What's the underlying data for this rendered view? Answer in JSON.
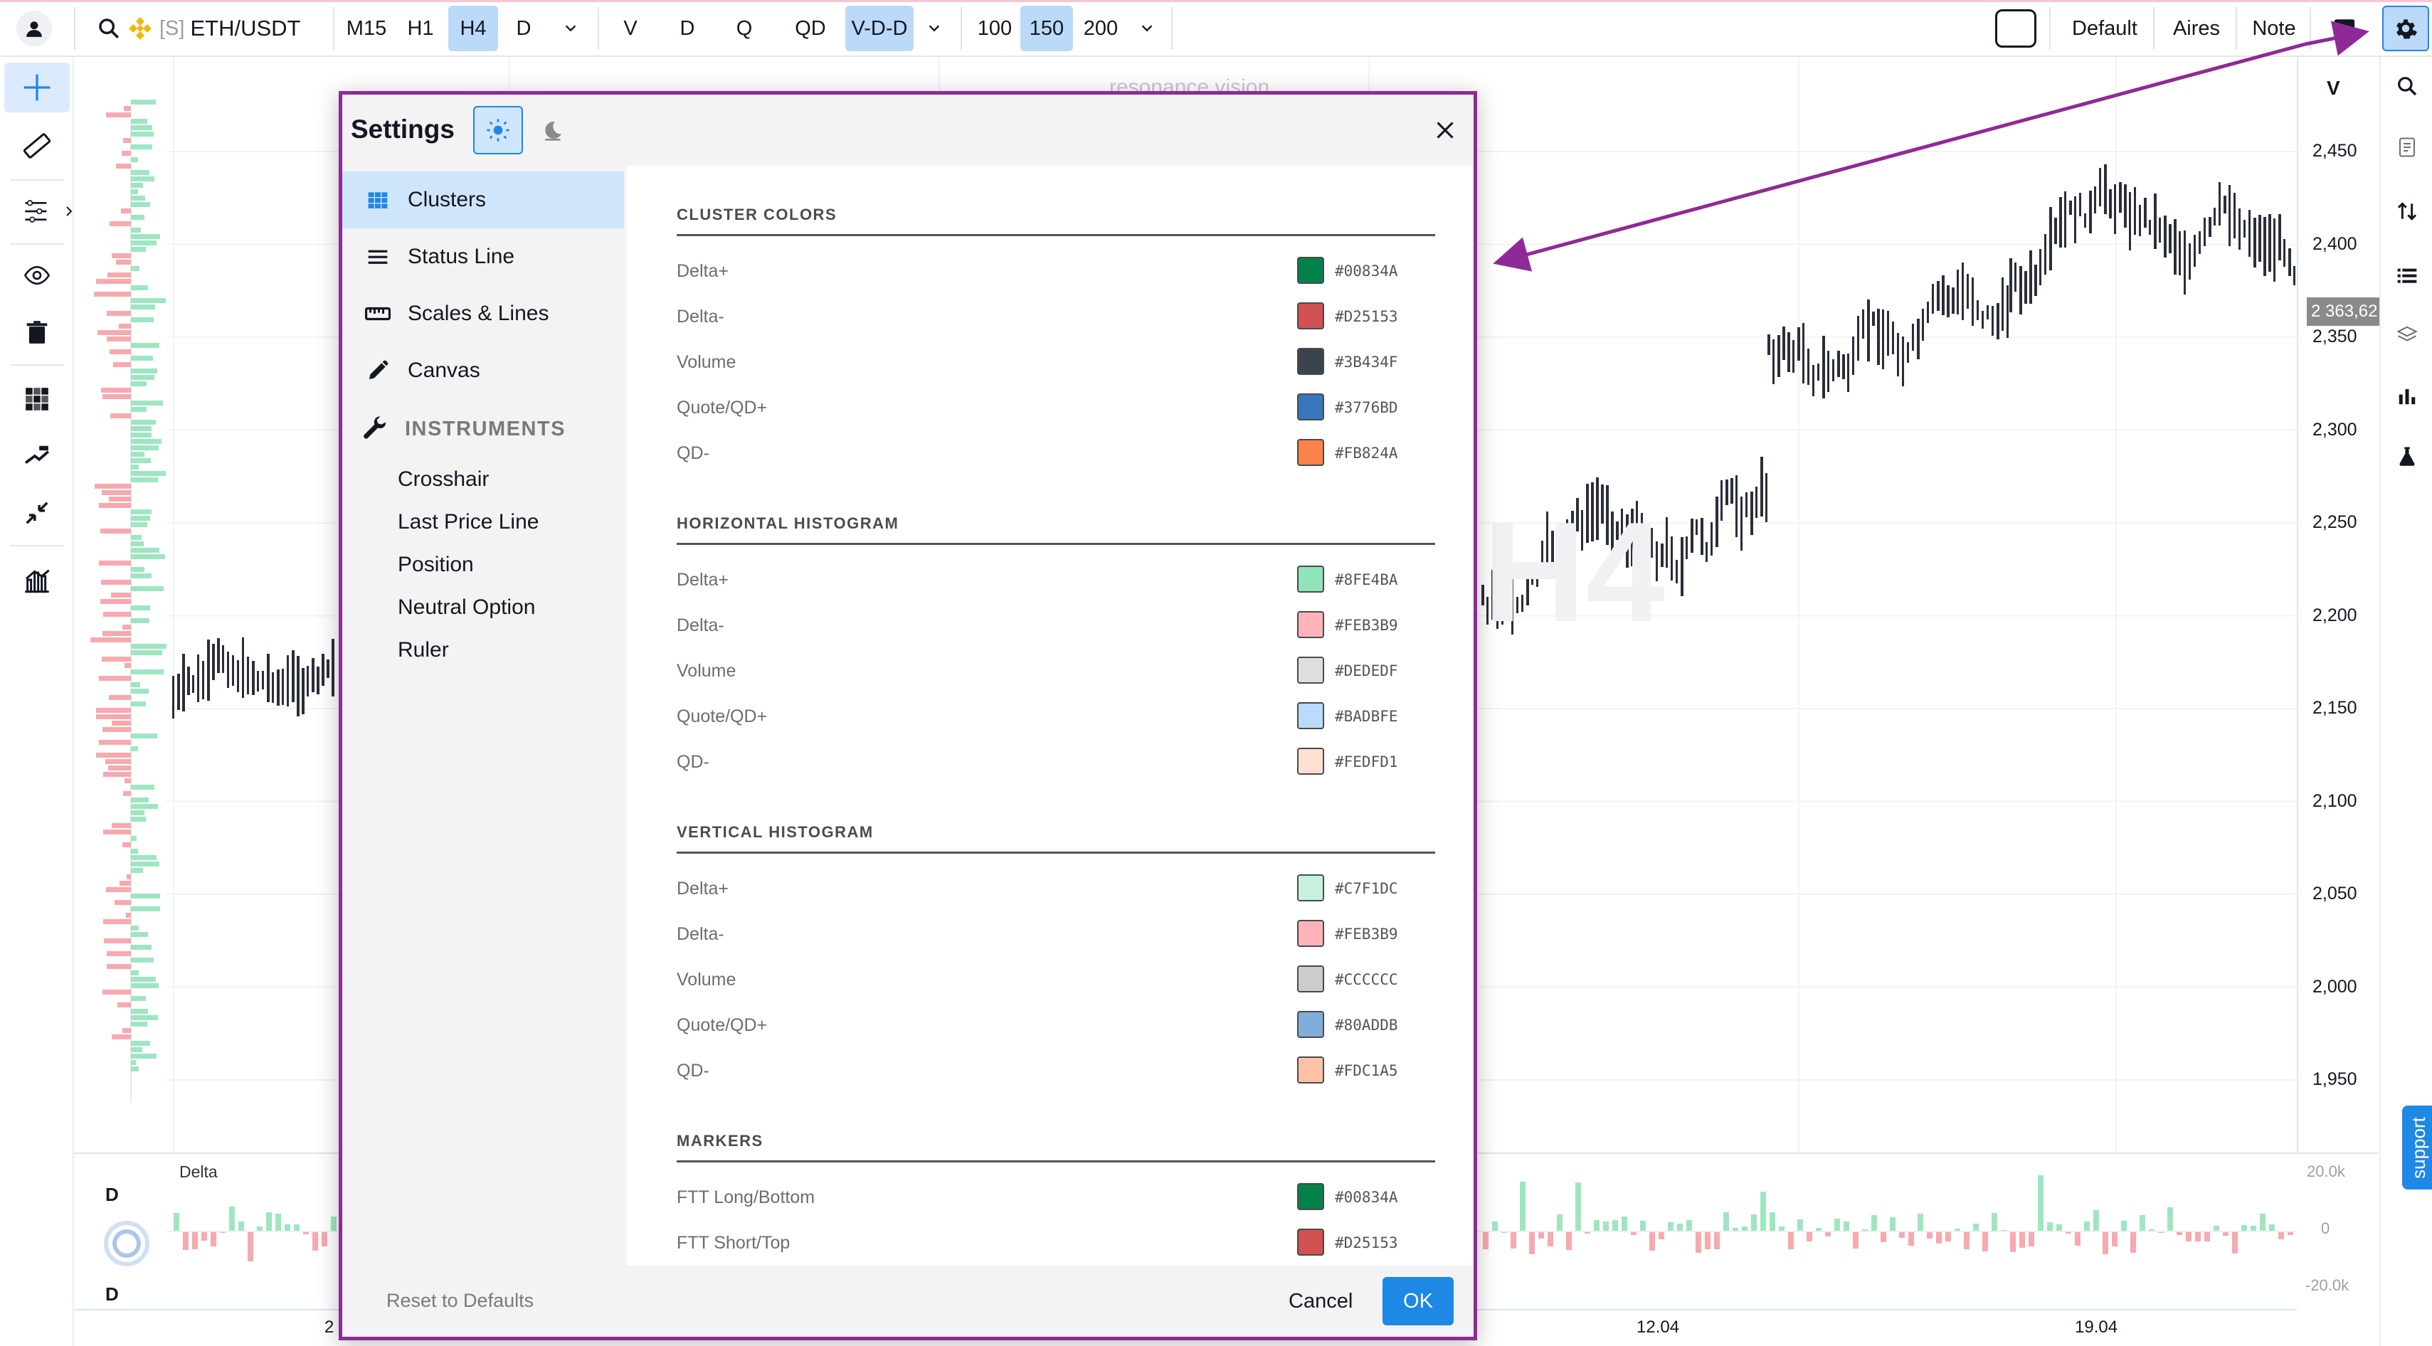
{
  "topbar": {
    "symbol_prefix": "[S]",
    "symbol": "ETH/USDT",
    "timeframes": [
      "M15",
      "H1",
      "H4",
      "D"
    ],
    "active_timeframe": "H4",
    "modes": [
      "V",
      "D",
      "Q",
      "QD",
      "V-D-D"
    ],
    "active_mode": "V-D-D",
    "counts": [
      "100",
      "150",
      "200"
    ],
    "active_count": "150",
    "layouts": [
      "Default",
      "Aires",
      "Note"
    ]
  },
  "chart": {
    "watermark_title": "resonance.vision",
    "watermark_tf": "H4",
    "price_header": "V",
    "price_ticks": [
      "2,450",
      "2,400",
      "2,350",
      "2,300",
      "2,250",
      "2,200",
      "2,150",
      "2,100",
      "2,050",
      "2,000",
      "1,950"
    ],
    "last_price": "2 363,62",
    "delta_panel": {
      "title": "Delta",
      "ticks": [
        "20.0k",
        "0",
        "-20.0k"
      ],
      "left_letter_top": "D",
      "left_letter_bottom": "D"
    },
    "dates": [
      "2",
      "12.04",
      "19.04"
    ],
    "support_label": "support"
  },
  "dialog": {
    "title": "Settings",
    "close_label": "×",
    "sidebar": {
      "items": [
        {
          "label": "Clusters",
          "icon": "grid-icon"
        },
        {
          "label": "Status Line",
          "icon": "lines-icon"
        },
        {
          "label": "Scales & Lines",
          "icon": "ruler-icon"
        },
        {
          "label": "Canvas",
          "icon": "pencil-icon"
        }
      ],
      "active": "Clusters",
      "instruments_heading": "INSTRUMENTS",
      "instruments": [
        "Crosshair",
        "Last Price Line",
        "Position",
        "Neutral Option",
        "Ruler"
      ]
    },
    "sections": [
      {
        "title": "CLUSTER COLORS",
        "rows": [
          {
            "label": "Delta+",
            "hex": "#00834A"
          },
          {
            "label": "Delta-",
            "hex": "#D25153"
          },
          {
            "label": "Volume",
            "hex": "#3B434F"
          },
          {
            "label": "Quote/QD+",
            "hex": "#3776BD"
          },
          {
            "label": "QD-",
            "hex": "#FB824A"
          }
        ]
      },
      {
        "title": "HORIZONTAL HISTOGRAM",
        "rows": [
          {
            "label": "Delta+",
            "hex": "#8FE4BA"
          },
          {
            "label": "Delta-",
            "hex": "#FEB3B9"
          },
          {
            "label": "Volume",
            "hex": "#DEDEDF"
          },
          {
            "label": "Quote/QD+",
            "hex": "#BADBFE"
          },
          {
            "label": "QD-",
            "hex": "#FEDFD1"
          }
        ]
      },
      {
        "title": "VERTICAL HISTOGRAM",
        "rows": [
          {
            "label": "Delta+",
            "hex": "#C7F1DC"
          },
          {
            "label": "Delta-",
            "hex": "#FEB3B9"
          },
          {
            "label": "Volume",
            "hex": "#CCCCCC"
          },
          {
            "label": "Quote/QD+",
            "hex": "#80ADDB"
          },
          {
            "label": "QD-",
            "hex": "#FDC1A5"
          }
        ]
      },
      {
        "title": "MARKERS",
        "rows": [
          {
            "label": "FTT Long/Bottom",
            "hex": "#00834A"
          },
          {
            "label": "FTT Short/Top",
            "hex": "#D25153"
          }
        ]
      }
    ],
    "footer": {
      "reset_label": "Reset to Defaults",
      "cancel_label": "Cancel",
      "ok_label": "OK"
    }
  },
  "colors": {
    "accent": "#1e88e5",
    "active_bg": "#bbd9f8",
    "annotation": "#8e2a97",
    "delta_pos": "#9ee6c0",
    "delta_neg": "#f7a9ae"
  }
}
